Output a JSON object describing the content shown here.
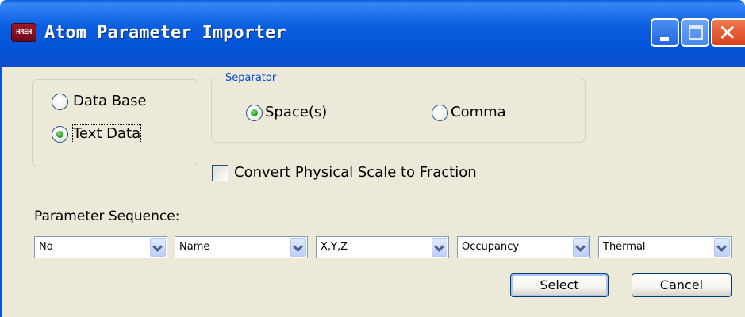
{
  "window": {
    "title": "Atom Parameter Importer",
    "app_icon_text": "HREH",
    "accent_color": "#0553d8",
    "client_background": "#ece9d8"
  },
  "source": {
    "options": [
      "Data Base",
      "Text Data"
    ],
    "selected": "Text Data"
  },
  "separator": {
    "legend": "Separator",
    "options": [
      "Space(s)",
      "Comma"
    ],
    "selected": "Space(s)"
  },
  "convert": {
    "label": "Convert Physical Scale to Fraction",
    "checked": false
  },
  "parameter_sequence": {
    "label": "Parameter Sequence:",
    "combos": [
      "No",
      "Name",
      "X,Y,Z",
      "Occupancy",
      "Thermal"
    ]
  },
  "buttons": {
    "select_label": "Select",
    "cancel_label": "Cancel"
  }
}
